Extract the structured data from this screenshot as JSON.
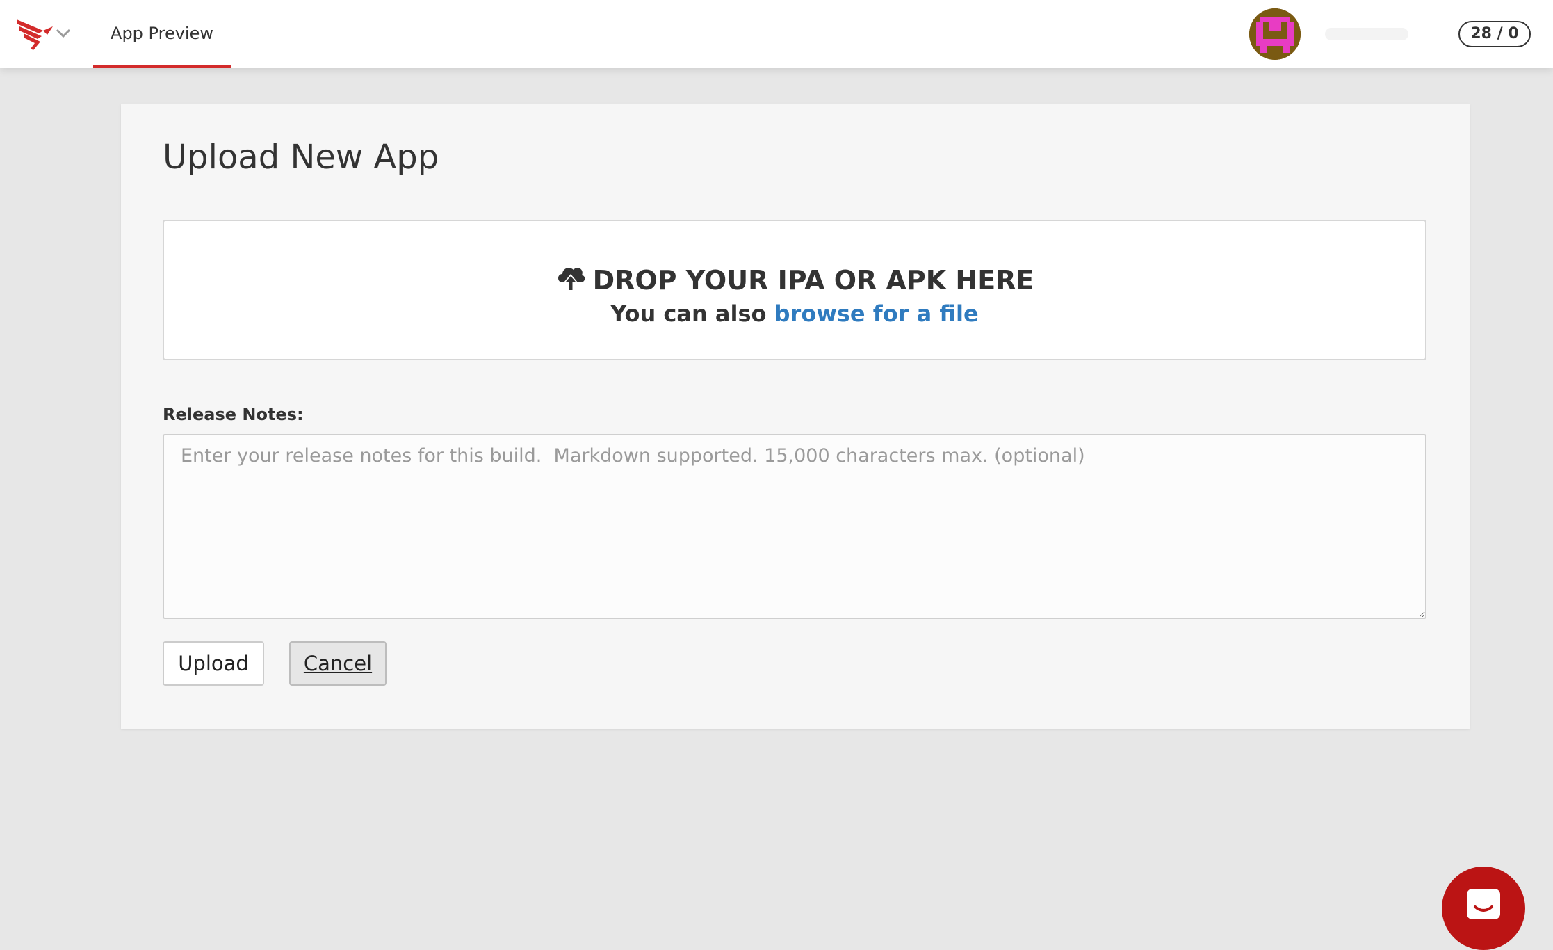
{
  "header": {
    "logo_icon": "red-bird-logo-icon",
    "menu_icon": "chevron-down-icon",
    "tab_label": "App Preview",
    "avatar_icon": "pixel-avatar-icon",
    "counter": "28 / 0",
    "accent_color": "#d32b2b"
  },
  "main": {
    "title": "Upload New App",
    "dropzone": {
      "icon": "cloud-upload-icon",
      "heading": "DROP YOUR IPA OR APK HERE",
      "subtext": "You can also ",
      "link_text": "browse for a file",
      "link_color": "#2f7bbf"
    },
    "release_notes": {
      "label": "Release Notes:",
      "value": "",
      "placeholder": "Enter your release notes for this build.  Markdown supported. 15,000 characters max. (optional)"
    },
    "buttons": {
      "upload": "Upload",
      "cancel": "Cancel"
    }
  },
  "chat": {
    "icon": "chat-bubble-icon",
    "color": "#bb1414"
  }
}
